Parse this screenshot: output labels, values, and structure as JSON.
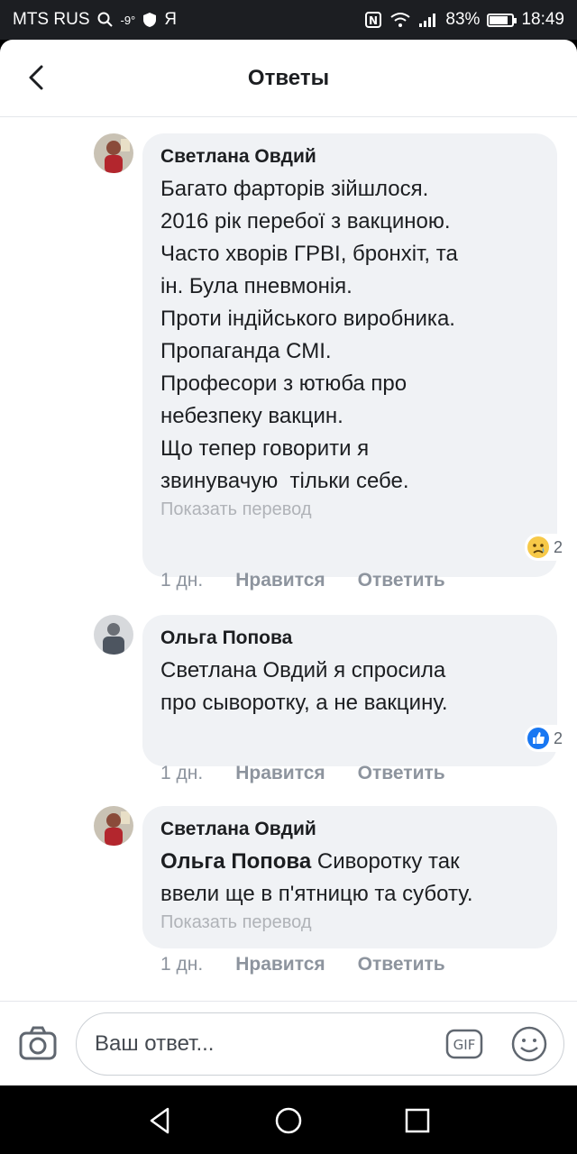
{
  "status_bar": {
    "carrier": "MTS RUS",
    "temperature": "-9°",
    "extra": "Я",
    "battery": "83%",
    "battery_level": 0.83,
    "time": "18:49"
  },
  "header": {
    "title": "Ответы"
  },
  "comments": [
    {
      "author": "Светлана Овдий",
      "text": "Багато фарторів зійшлося.\n2016 рік перебої з вакциною.\nЧасто хворів ГРВІ, бронхіт, та\nін. Була пневмонія.\nПроти індійського виробника.\nПропаганда СМІ.\nПрофесори з ютюба про\nнебезпеку вакцин.\nЩо тепер говорити я\nзвинувачую  тільки себе.",
      "translate": "Показать перевод",
      "reaction_icon": "sad-face-icon",
      "reaction_count": "2",
      "time": "1 дн.",
      "like": "Нравится",
      "reply": "Ответить"
    },
    {
      "author": "Ольга Попова",
      "text": "Светлана Овдий я спросила\nпро сыворотку, а не вакцину.",
      "reaction_icon": "thumbs-up-icon",
      "reaction_count": "2",
      "time": "1 дн.",
      "like": "Нравится",
      "reply": "Ответить"
    },
    {
      "author": "Светлана Овдий",
      "mention": "Ольга Попова",
      "text": " Сиворотку так\nввели ще в п'ятницю та суботу.",
      "translate": "Показать перевод",
      "time": "1 дн.",
      "like": "Нравится",
      "reply": "Ответить"
    }
  ],
  "reply_bar": {
    "placeholder": "Ваш ответ...",
    "gif_label": "GIF"
  },
  "colors": {
    "bubble": "#f0f2f5",
    "like_blue": "#1877f2",
    "sad_yellow": "#f7c948"
  }
}
